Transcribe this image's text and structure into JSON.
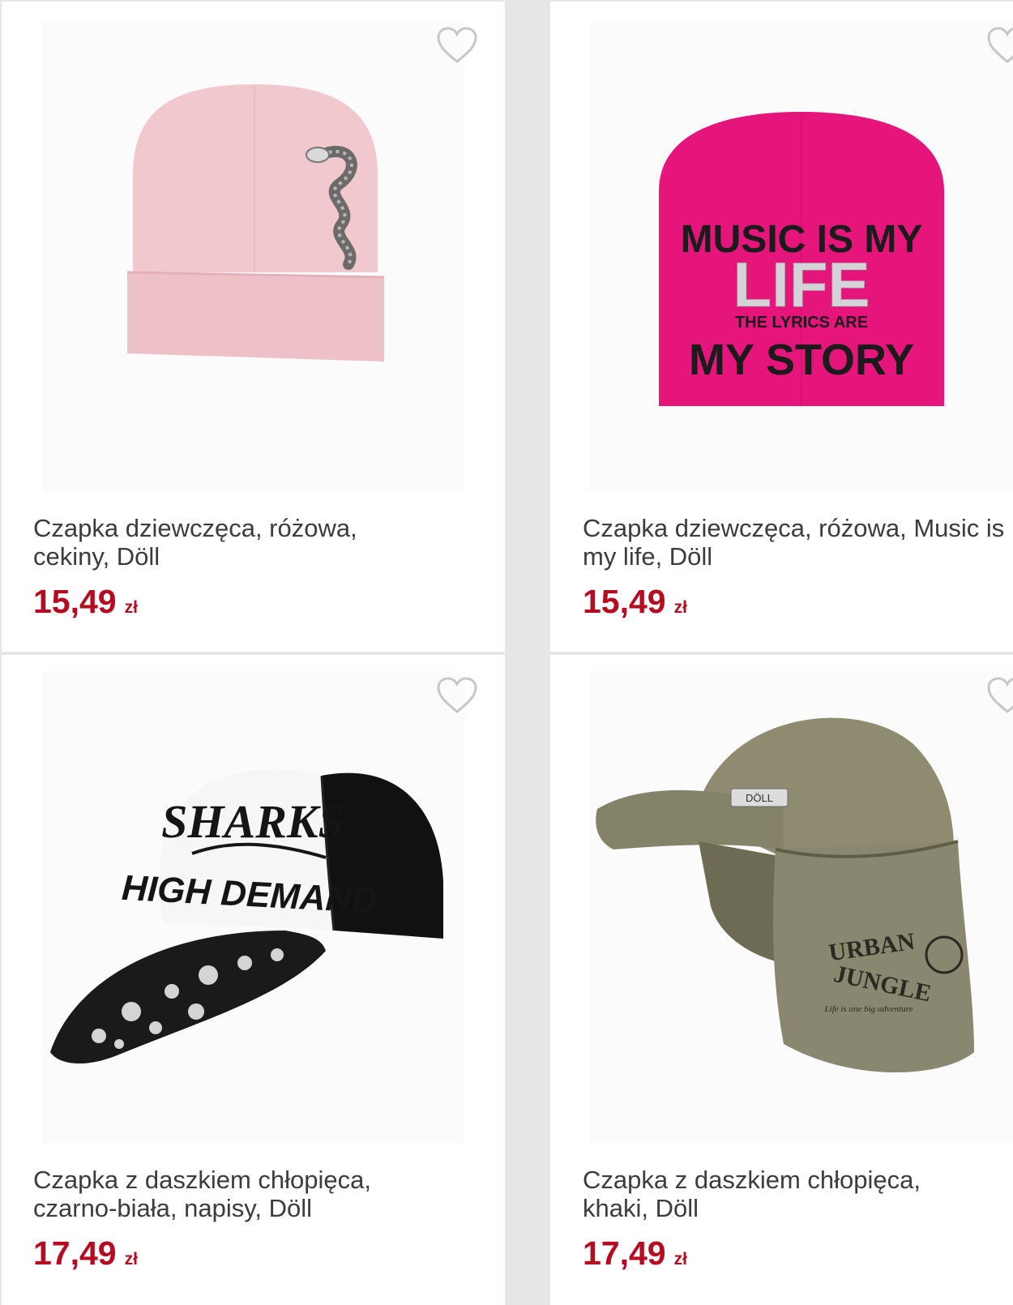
{
  "products": [
    {
      "title": "Czapka dziewczęca, różowa, cekiny, Döll",
      "price": "15,49",
      "currency": "zł",
      "wishlist_icon": "heart-outline-icon",
      "image": "pink-beanie-sequin-snake"
    },
    {
      "title": "Czapka dziewczęca, różowa, Music is my life, Döll",
      "price": "15,49",
      "currency": "zł",
      "wishlist_icon": "heart-outline-icon",
      "image": "magenta-beanie-music-is-my-life",
      "print": {
        "line1": "MUSIC IS MY",
        "line2": "LIFE",
        "line3": "THE LYRICS ARE",
        "line4": "MY STORY"
      }
    },
    {
      "title": "Czapka z daszkiem chłopięca, czarno-biała, napisy, Döll",
      "price": "17,49",
      "currency": "zł",
      "wishlist_icon": "heart-outline-icon",
      "image": "black-white-cap-sharks",
      "print": {
        "line1": "SHARKS",
        "line2": "HIGH DEMAND"
      }
    },
    {
      "title": "Czapka z daszkiem chłopięca, khaki, Döll",
      "price": "17,49",
      "currency": "zł",
      "wishlist_icon": "heart-outline-icon",
      "image": "khaki-cap-urban-jungle",
      "print": {
        "line1": "URBAN",
        "line2": "JUNGLE",
        "line3": "Life is one big adventure",
        "badge": "DÖLL"
      }
    }
  ],
  "colors": {
    "price": "#b50c22",
    "title": "#3c3c3c",
    "card": "#ffffff",
    "grid_gap": "#e6e6e6"
  }
}
